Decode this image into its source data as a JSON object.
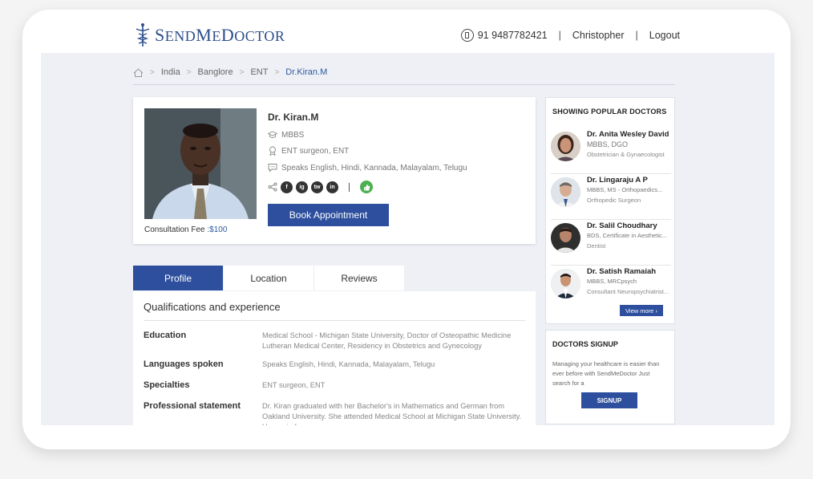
{
  "brand": {
    "logo_text_big": "S",
    "logo_text_rest": "END",
    "logo_text_big2": "M",
    "logo_text_rest2": "E",
    "logo_text_big3": "D",
    "logo_text_rest3": "OCTOR",
    "accent": "#2d4f9e"
  },
  "header": {
    "phone": "91 9487782421",
    "user": "Christopher",
    "logout": "Logout"
  },
  "breadcrumb": [
    "India",
    "Banglore",
    "ENT",
    "Dr.Kiran.M"
  ],
  "doctor": {
    "name": "Dr. Kiran.M",
    "degree": "MBBS",
    "specialty": "ENT surgeon, ENT",
    "languages": "Speaks English, Hindi, Kannada, Malayalam, Telugu",
    "fee_label": "Consultation Fee",
    "fee_value": ":$100",
    "book_label": "Book Appointment",
    "social": [
      "f",
      "ig",
      "tw",
      "in"
    ]
  },
  "tabs": [
    "Profile",
    "Location",
    "Reviews"
  ],
  "qualifications": {
    "title": "Qualifications and experience",
    "rows": [
      {
        "label": "Education",
        "value": "Medical School - Michigan State University, Doctor of Osteopathic Medicine Lutheran Medical Center, Residency in Obstetrics and Gynecology"
      },
      {
        "label": "Languages spoken",
        "value": "Speaks English, Hindi, Kannada, Malayalam, Telugu"
      },
      {
        "label": "Specialties",
        "value": "ENT surgeon, ENT"
      },
      {
        "label": "Professional statement",
        "value": "Dr. Kiran graduated with her Bachelor's in Mathematics and German from Oakland University. She attended Medical School at Michigan State University. Her main focus."
      }
    ]
  },
  "popular": {
    "title": "SHOWING POPULAR DOCTORS",
    "doctors": [
      {
        "name": "Dr. Anita Wesley David",
        "degree": "MBBS, DGO",
        "specialty": "Obstetrician & Gynaecologist"
      },
      {
        "name": "Dr. Lingaraju A P",
        "degree": "MBBS, MS - Orthopaedics...",
        "specialty": "Orthopedic Surgeon"
      },
      {
        "name": "Dr. Salil Choudhary",
        "degree": "BDS, Certificate in Aesthetic...",
        "specialty": "Dentist"
      },
      {
        "name": "Dr. Satish Ramaiah",
        "degree": "MBBS, MRCpsych",
        "specialty": "Consultant Neuropsychiatrist..."
      }
    ],
    "view_more": "View more ›"
  },
  "signup": {
    "title": "DOCTORS  SIGNUP",
    "text": "Managing your healthcare is easier than ever before with SendMeDoctor Just search for a",
    "button": "SIGNUP"
  }
}
